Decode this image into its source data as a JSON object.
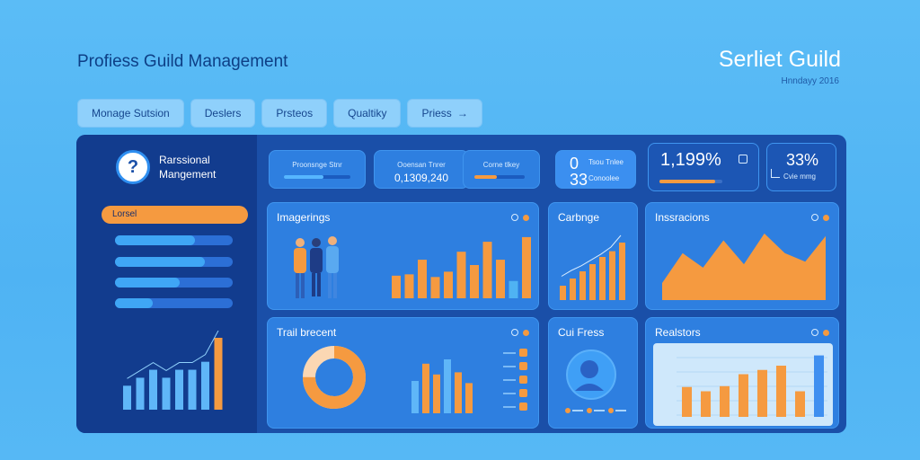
{
  "header": {
    "app_title": "Profiess Guild Management",
    "brand_title": "Serliet Guild",
    "brand_date": "Hnndayy 2016"
  },
  "tabs": [
    {
      "label": "Monage Sutsion"
    },
    {
      "label": "Deslers"
    },
    {
      "label": "Prsteos"
    },
    {
      "label": "Qualtiky"
    },
    {
      "label": "Priess",
      "arrow": "→"
    }
  ],
  "sidebar": {
    "profile_icon": "?",
    "profile_name_line1": "Rarssional",
    "profile_name_line2": "Mangement",
    "active_item": "Lorsel",
    "progress_items": [
      0.68,
      0.76,
      0.55,
      0.32
    ],
    "chart_values": [
      3,
      4,
      5,
      4,
      5,
      5,
      6,
      9
    ]
  },
  "kpis": [
    {
      "label": "Proonsnge Stnr",
      "value": "",
      "progress": 0.6
    },
    {
      "label": "Ooensan Tnrer",
      "value": "0,1309,240",
      "progress": null
    },
    {
      "label": "Corne tlkey",
      "value": "",
      "progress": 0.45,
      "accent": "#f59a40"
    },
    {
      "label": "Tsou Tnlee",
      "value_big_top": "0",
      "value_big_bottom": "33",
      "sub": "Conoolee"
    },
    {
      "value": "1,199%",
      "progress": 0.88
    },
    {
      "value": "33%",
      "label": "Cvie mmg"
    }
  ],
  "cards": {
    "imagerings": {
      "title": "Imagerings",
      "values": [
        34,
        36,
        58,
        32,
        40,
        70,
        50,
        85,
        58,
        26,
        92
      ]
    },
    "carbonge": {
      "title": "Carbnge",
      "values": [
        20,
        30,
        40,
        50,
        60,
        68,
        80
      ],
      "line": [
        10,
        20,
        28,
        38,
        48,
        60,
        80
      ]
    },
    "instractions": {
      "title": "Inssracions",
      "values": [
        20,
        55,
        38,
        70,
        42,
        78,
        55,
        45,
        75
      ]
    },
    "trail_brecent": {
      "title": "Trail brecent",
      "donut": [
        0.75,
        0.25
      ],
      "bars": [
        30,
        46,
        36,
        50,
        38,
        28
      ],
      "legend_count": 5
    },
    "cui_fress": {
      "title": "Cui Fress",
      "legend_count": 3
    },
    "realstors": {
      "title": "Realstors",
      "values": [
        35,
        30,
        36,
        50,
        55,
        60,
        30,
        72
      ]
    }
  },
  "colors": {
    "orange": "#f59a40",
    "blue_bar": "#3fa6f5",
    "panel": "#2e7fe0",
    "dark": "#123c8e"
  }
}
